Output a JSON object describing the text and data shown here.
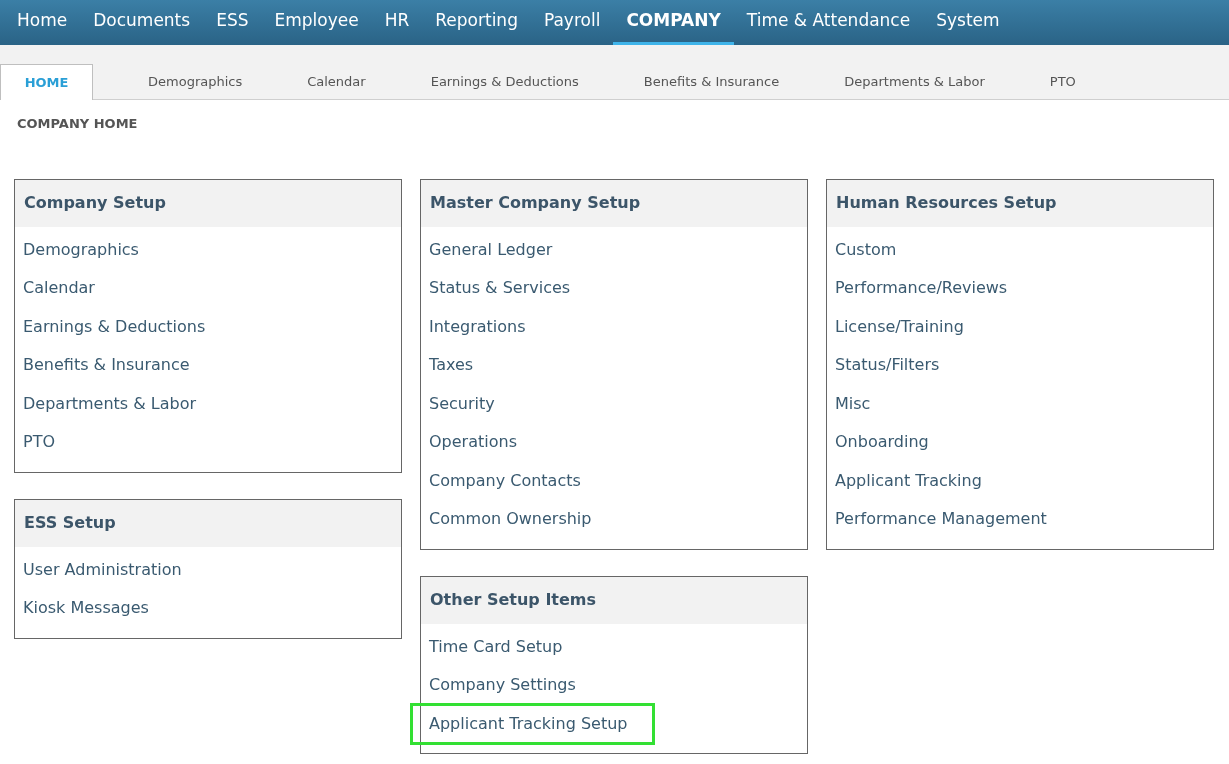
{
  "top_nav": [
    {
      "label": "Home",
      "selected": false
    },
    {
      "label": "Documents",
      "selected": false
    },
    {
      "label": "ESS",
      "selected": false
    },
    {
      "label": "Employee",
      "selected": false
    },
    {
      "label": "HR",
      "selected": false
    },
    {
      "label": "Reporting",
      "selected": false
    },
    {
      "label": "Payroll",
      "selected": false
    },
    {
      "label": "COMPANY",
      "selected": true
    },
    {
      "label": "Time & Attendance",
      "selected": false
    },
    {
      "label": "System",
      "selected": false
    }
  ],
  "sub_tabs": [
    {
      "label": "HOME",
      "selected": true
    },
    {
      "label": "Demographics",
      "selected": false
    },
    {
      "label": "Calendar",
      "selected": false
    },
    {
      "label": "Earnings & Deductions",
      "selected": false
    },
    {
      "label": "Benefits & Insurance",
      "selected": false
    },
    {
      "label": "Departments & Labor",
      "selected": false
    },
    {
      "label": "PTO",
      "selected": false
    }
  ],
  "breadcrumb": "COMPANY HOME",
  "columns": [
    [
      {
        "title": "Company Setup",
        "items": [
          {
            "label": "Demographics"
          },
          {
            "label": "Calendar"
          },
          {
            "label": "Earnings & Deductions"
          },
          {
            "label": "Benefits & Insurance"
          },
          {
            "label": "Departments & Labor"
          },
          {
            "label": "PTO"
          }
        ]
      },
      {
        "title": "ESS Setup",
        "items": [
          {
            "label": "User Administration"
          },
          {
            "label": "Kiosk Messages"
          }
        ]
      }
    ],
    [
      {
        "title": "Master Company Setup",
        "items": [
          {
            "label": "General Ledger"
          },
          {
            "label": "Status & Services"
          },
          {
            "label": "Integrations"
          },
          {
            "label": "Taxes"
          },
          {
            "label": "Security"
          },
          {
            "label": "Operations"
          },
          {
            "label": "Company Contacts"
          },
          {
            "label": "Common Ownership"
          }
        ]
      },
      {
        "title": "Other Setup Items",
        "items": [
          {
            "label": "Time Card Setup",
            "highlighted": false
          },
          {
            "label": "Company Settings",
            "highlighted": false
          },
          {
            "label": "Applicant Tracking Setup",
            "highlighted": true
          }
        ]
      }
    ],
    [
      {
        "title": "Human Resources Setup",
        "items": [
          {
            "label": "Custom"
          },
          {
            "label": "Performance/Reviews"
          },
          {
            "label": "License/Training"
          },
          {
            "label": "Status/Filters"
          },
          {
            "label": "Misc"
          },
          {
            "label": "Onboarding"
          },
          {
            "label": "Applicant Tracking"
          },
          {
            "label": "Performance Management"
          }
        ]
      }
    ]
  ]
}
